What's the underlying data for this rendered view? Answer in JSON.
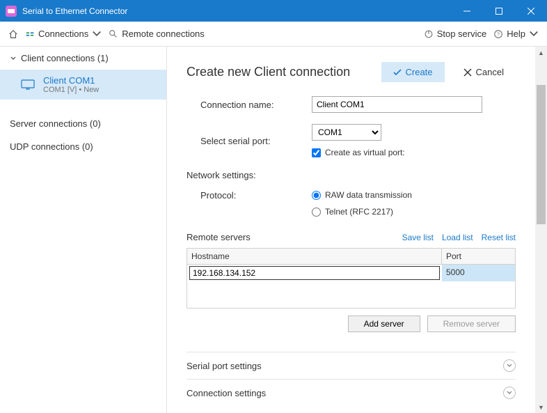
{
  "app": {
    "title": "Serial to Ethernet Connector"
  },
  "toolbar": {
    "connections": "Connections",
    "remote_connections": "Remote connections",
    "stop_service": "Stop service",
    "help": "Help"
  },
  "sidebar": {
    "client_group": "Client connections (1)",
    "server_group": "Server connections (0)",
    "udp_group": "UDP connections (0)",
    "items": [
      {
        "name": "Client COM1",
        "sub": "COM1 [V] • New"
      }
    ]
  },
  "page": {
    "title": "Create new Client connection",
    "create": "Create",
    "cancel": "Cancel"
  },
  "form": {
    "connection_name_label": "Connection name:",
    "connection_name_value": "Client COM1",
    "select_port_label": "Select serial port:",
    "select_port_value": "COM1",
    "create_virtual_label": "Create as virtual port:",
    "create_virtual_checked": true
  },
  "network": {
    "section_title": "Network settings:",
    "protocol_label": "Protocol:",
    "raw_label": "RAW data transmission",
    "telnet_label": "Telnet (RFC 2217)"
  },
  "remote": {
    "title": "Remote servers",
    "save_list": "Save list",
    "load_list": "Load list",
    "reset_list": "Reset list",
    "col_hostname": "Hostname",
    "col_port": "Port",
    "rows": [
      {
        "hostname": "192.168.134.152",
        "port": "5000"
      }
    ],
    "add_server": "Add server",
    "remove_server": "Remove server"
  },
  "sections": {
    "serial_port": "Serial port settings",
    "connection": "Connection settings"
  }
}
